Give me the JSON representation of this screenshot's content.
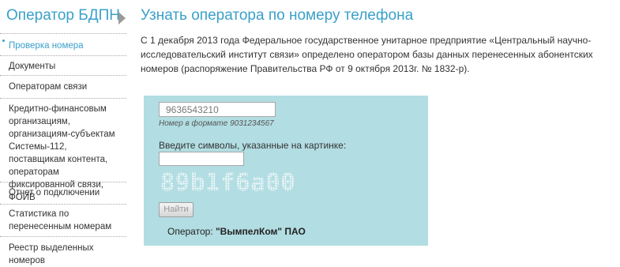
{
  "sidebar": {
    "brand": "Оператор БДПН",
    "items": [
      {
        "label": "Проверка номера"
      },
      {
        "label": "Документы"
      },
      {
        "label": "Операторам связи"
      },
      {
        "label": "Кредитно-финансовым организациям, организациям-субъектам Системы-112, поставщикам контента, операторам фиксированной связи, ФОИВ"
      },
      {
        "label": "Отчет о подключении"
      },
      {
        "label": "Статистика по перенесенным номерам"
      },
      {
        "label": "Реестр выделенных номеров"
      }
    ]
  },
  "main": {
    "title": "Узнать оператора по номеру телефона",
    "intro": "С 1 декабря 2013 года Федеральное государственное унитарное предприятие «Центральный научно-исследовательский институт связи» определено оператором базы данных перенесенных абонентских номеров (распоряжение Правительства РФ от 9 октября 2013г. № 1832-р)."
  },
  "form": {
    "phone_value": "9636543210",
    "phone_hint": "Номер в формате 9031234567",
    "captcha_label": "Введите символы, указанные на картинке:",
    "captcha_value": "",
    "captcha_text": "89b1f6a00",
    "submit_label": "Найти"
  },
  "result": {
    "prefix": "Оператор:",
    "operator": "\"ВымпелКом\" ПАО"
  },
  "colors": {
    "accent": "#3aa0c9",
    "panel": "#b2dde2"
  }
}
